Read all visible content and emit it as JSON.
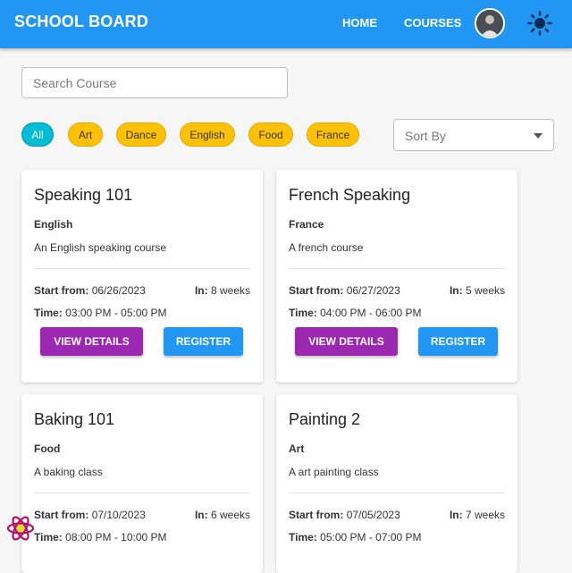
{
  "app": {
    "title": "SCHOOL BOARD"
  },
  "nav": {
    "home": "HOME",
    "courses": "COURSES"
  },
  "icons": {
    "avatar": "user-avatar",
    "theme": "sun-icon",
    "devtool": "react-icon"
  },
  "search": {
    "placeholder": "Search Course"
  },
  "filters": [
    "All",
    "Art",
    "Dance",
    "English",
    "Food",
    "France"
  ],
  "sort": {
    "placeholder": "Sort By"
  },
  "labels": {
    "start_from": "Start from:",
    "in": "In:",
    "time": "Time:",
    "view_details": "VIEW DETAILS",
    "register": "REGISTER"
  },
  "courses": [
    {
      "title": "Speaking 101",
      "category": "English",
      "description": "An English speaking course",
      "start": "06/26/2023",
      "duration": "8 weeks",
      "time": "03:00 PM - 05:00 PM"
    },
    {
      "title": "French Speaking",
      "category": "France",
      "description": "A french course",
      "start": "06/27/2023",
      "duration": "5 weeks",
      "time": "04:00 PM - 06:00 PM"
    },
    {
      "title": "Baking 101",
      "category": "Food",
      "description": "A baking class",
      "start": "07/10/2023",
      "duration": "6 weeks",
      "time": "08:00 PM - 10:00 PM"
    },
    {
      "title": "Painting 2",
      "category": "Art",
      "description": "A art painting class",
      "start": "07/05/2023",
      "duration": "7 weeks",
      "time": "05:00 PM - 07:00 PM"
    }
  ],
  "colors": {
    "appbar": "#2196f3",
    "chip": "#ffc107",
    "chip_active": "#00bcd4",
    "view_button": "#9c27b0",
    "register_button": "#2196f3"
  }
}
